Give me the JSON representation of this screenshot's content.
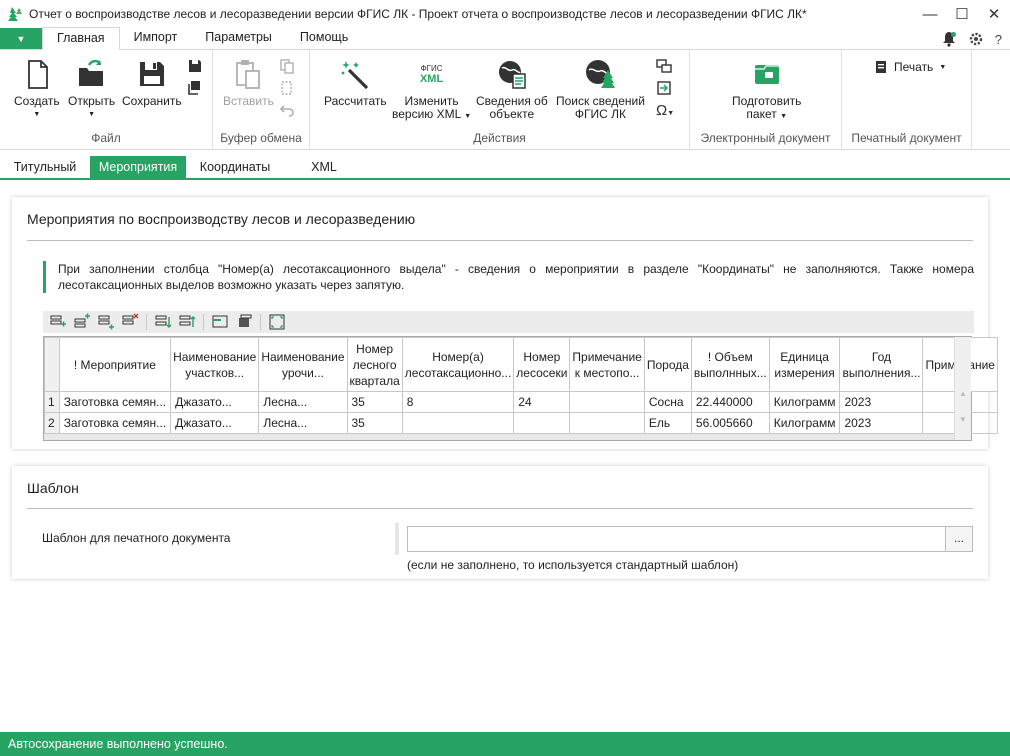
{
  "window": {
    "title": "Отчет о воспроизводстве лесов и лесоразведении версии ФГИС ЛК - Проект отчета о воспроизводстве лесов и лесоразведении ФГИС ЛК*",
    "controls": {
      "minimize": "—",
      "maximize": "☐",
      "close": "✕"
    }
  },
  "menu": {
    "tabs": [
      "Главная",
      "Импорт",
      "Параметры",
      "Помощь"
    ],
    "active": "Главная",
    "right_icons": [
      "bell-icon",
      "settings-icon",
      "help-icon"
    ]
  },
  "ribbon": {
    "file": {
      "label": "Файл",
      "create": "Создать",
      "open": "Открыть",
      "save": "Сохранить"
    },
    "clipboard": {
      "label": "Буфер обмена",
      "paste": "Вставить"
    },
    "actions": {
      "label": "Действия",
      "calculate": "Рассчитать",
      "change_xml_1": "Изменить",
      "change_xml_2": "версию XML",
      "object_info_1": "Сведения об",
      "object_info_2": "объекте",
      "search_1": "Поиск сведений",
      "search_2": "ФГИС ЛК",
      "xml_logo_1": "ФГИС",
      "xml_logo_2": "XML"
    },
    "edoc": {
      "label": "Электронный документ",
      "prepare_1": "Подготовить",
      "prepare_2": "пакет"
    },
    "print": {
      "label": "Печатный документ",
      "print": "Печать"
    }
  },
  "section_tabs": [
    "Титульный",
    "Мероприятия",
    "Координаты",
    "XML"
  ],
  "events_panel": {
    "title": "Мероприятия по воспроизводству лесов и лесоразведению",
    "note": "При заполнении столбца \"Номер(а) лесотаксационного выдела\" - сведения о мероприятии в разделе \"Координаты\" не заполняются. Также номера лесотаксационных выделов возможно указать через запятую.",
    "columns": [
      "! Мероприятие",
      "Наименование участков...",
      "Наименование урочи...",
      "Номер лесного квартала",
      "Номер(а) лесотаксационно...",
      "Номер лесосеки",
      "Примечание к местопо...",
      "Порода",
      "! Объем выполнных...",
      "Единица измерения",
      "Год выполнения...",
      "Примечание"
    ],
    "rows": [
      {
        "num": "1",
        "cells": [
          "Заготовка семян...",
          "Джазато...",
          "Лесна...",
          "35",
          "8",
          "24",
          "",
          "Сосна",
          "22.440000",
          "Килограмм",
          "2023",
          ""
        ]
      },
      {
        "num": "2",
        "cells": [
          "Заготовка семян...",
          "Джазато...",
          "Лесна...",
          "35",
          "",
          "",
          "",
          "Ель",
          "56.005660",
          "Килограмм",
          "2023",
          ""
        ]
      }
    ]
  },
  "template_panel": {
    "title": "Шаблон",
    "field_label": "Шаблон для печатного документа",
    "value": "",
    "browse": "...",
    "hint": "(если не заполнено, то используется стандартный шаблон)"
  },
  "status": "Автосохранение выполнено успешно.",
  "colors": {
    "accent": "#27a464"
  }
}
